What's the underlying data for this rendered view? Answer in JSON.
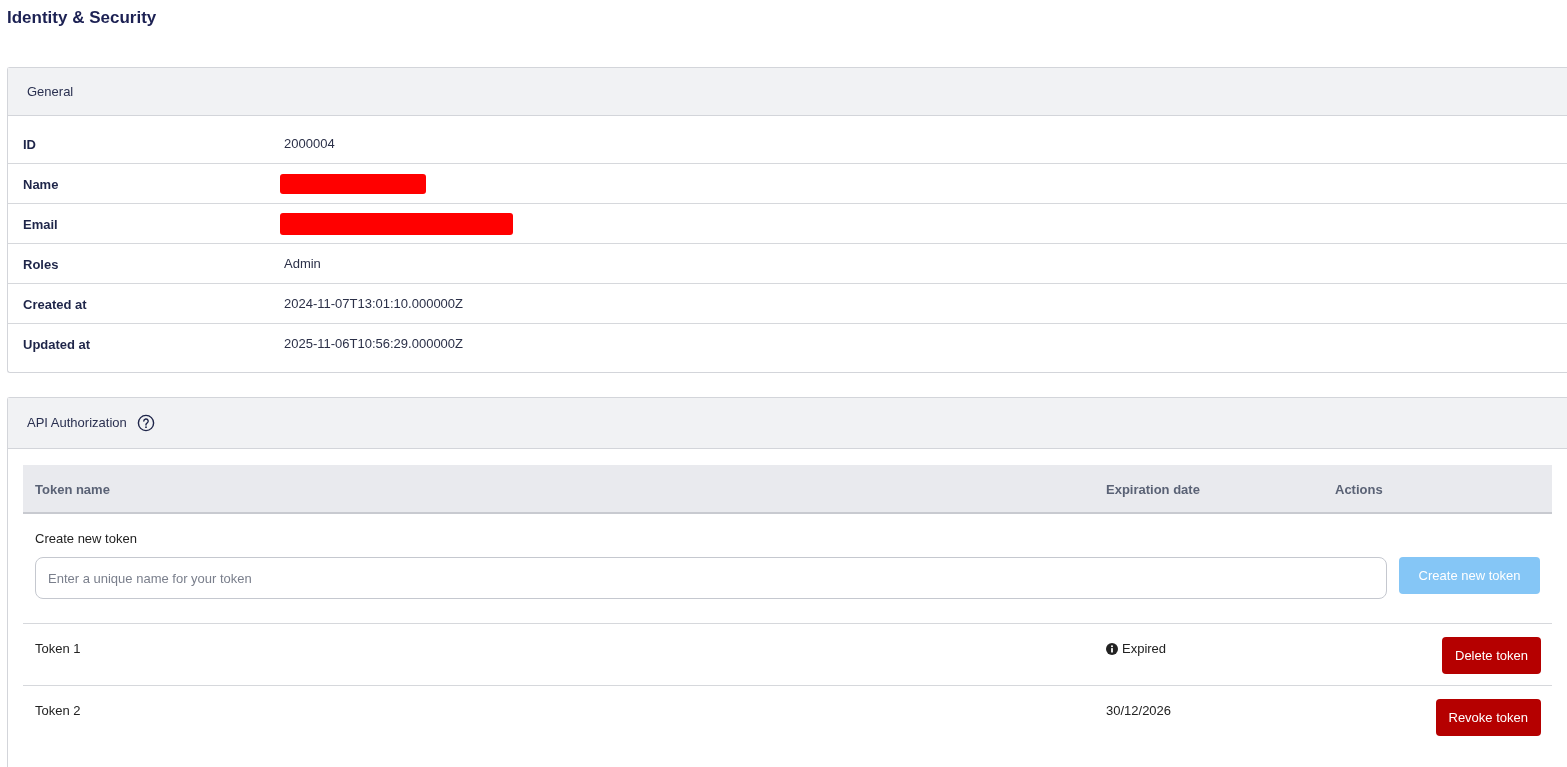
{
  "page": {
    "title": "Identity & Security"
  },
  "general": {
    "title": "General",
    "rows": [
      {
        "label": "ID",
        "kind": "text",
        "value": "2000004"
      },
      {
        "label": "Name",
        "kind": "redacted"
      },
      {
        "label": "Email",
        "kind": "redacted"
      },
      {
        "label": "Roles",
        "kind": "text",
        "value": "Admin"
      },
      {
        "label": "Created at",
        "kind": "text",
        "value": "2024-11-07T13:01:10.000000Z"
      },
      {
        "label": "Updated at",
        "kind": "text",
        "value": "2025-11-06T10:56:29.000000Z"
      }
    ]
  },
  "api_authorization": {
    "title": "API Authorization",
    "columns": [
      "Token name",
      "Expiration date",
      "Actions"
    ],
    "create": {
      "label": "Create new token",
      "placeholder": "Enter a unique name for your token",
      "button": {
        "label": "Create new token",
        "disabled": true
      }
    },
    "tokens": [
      {
        "name": "Token 1",
        "expiration": "Expired",
        "expired": true,
        "action": "Delete token"
      },
      {
        "name": "Token 2",
        "expiration": "30/12/2026",
        "expired": false,
        "action": "Revoke token"
      }
    ]
  }
}
